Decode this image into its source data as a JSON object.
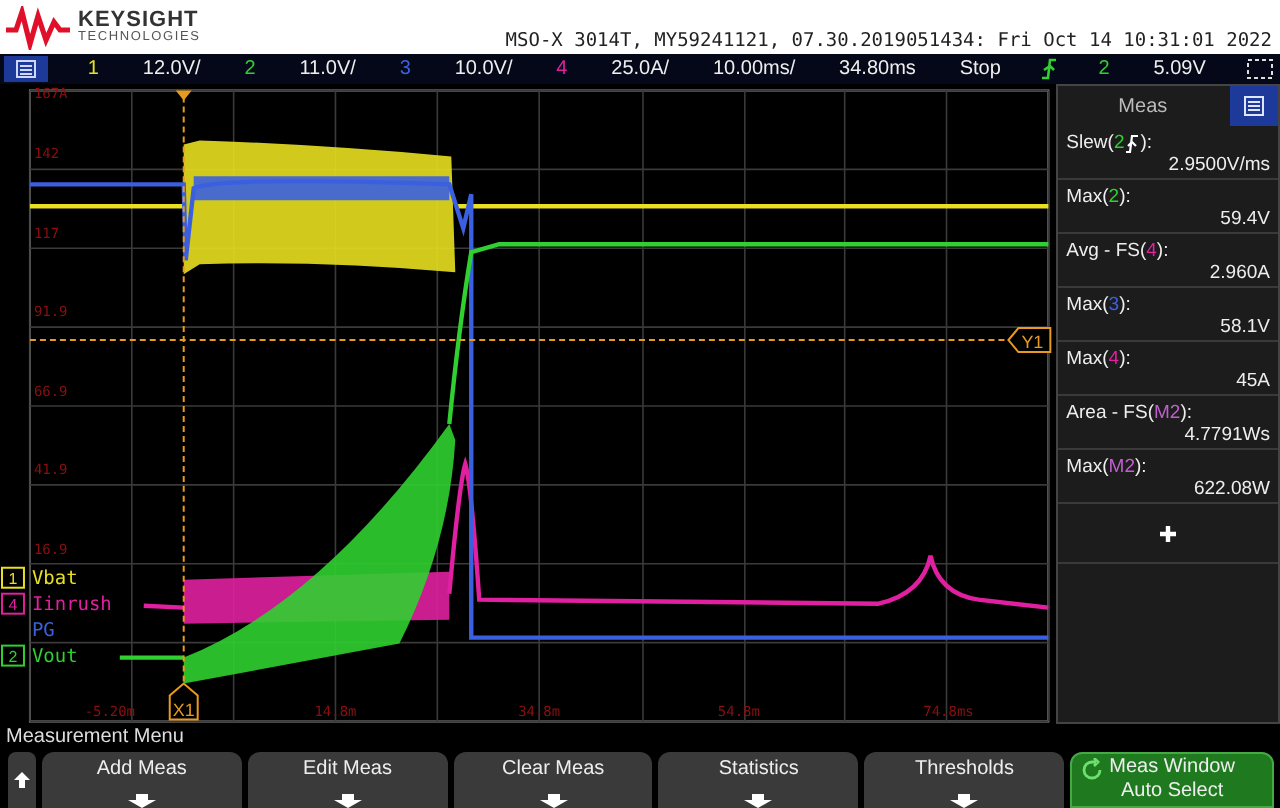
{
  "header": {
    "brand": "KEYSIGHT",
    "brand_sub": "TECHNOLOGIES",
    "instrument": "MSO-X 3014T, MY59241121, 07.30.2019051434: Fri Oct 14 10:31:01 2022"
  },
  "channel_bar": {
    "channels": [
      {
        "number": "1",
        "scale": "12.0V/",
        "color": "#e8e020"
      },
      {
        "number": "2",
        "scale": "11.0V/",
        "color": "#30d030"
      },
      {
        "number": "3",
        "scale": "10.0V/",
        "color": "#3a60e0"
      },
      {
        "number": "4",
        "scale": "25.0A/",
        "color": "#e020a0"
      }
    ],
    "timebase": "10.00ms/",
    "delay": "34.80ms",
    "run_state": "Stop",
    "trigger": {
      "source": "2",
      "color": "#30d030",
      "level": "5.09V"
    }
  },
  "display": {
    "y_labels": [
      "167A",
      "142",
      "117",
      "91.9",
      "66.9",
      "41.9",
      "16.9"
    ],
    "x_labels": [
      "-5.20m",
      "14.8m",
      "34.8m",
      "54.8m",
      "74.8ms"
    ],
    "x_cursor": "X1",
    "y_cursor": "Y1",
    "traces": [
      {
        "label": "Vbat",
        "number": "1",
        "color": "#e8e020"
      },
      {
        "label": "Iinrush",
        "number": "4",
        "color": "#e020a0"
      },
      {
        "label": "PG",
        "color": "#3a60e0"
      },
      {
        "label": "Vout",
        "number": "2",
        "color": "#30d030"
      }
    ]
  },
  "meas_panel": {
    "title": "Meas",
    "items": [
      {
        "prefix": "Slew(",
        "source": "2",
        "color": "#30d030",
        "edge": true,
        "suffix": "):",
        "value": "2.9500V/ms"
      },
      {
        "prefix": "Max(",
        "source": "2",
        "color": "#30d030",
        "edge": false,
        "suffix": "):",
        "value": "59.4V"
      },
      {
        "prefix": "Avg - FS(",
        "source": "4",
        "color": "#e020a0",
        "edge": false,
        "suffix": "):",
        "value": "2.960A"
      },
      {
        "prefix": "Max(",
        "source": "3",
        "color": "#3a60e0",
        "edge": false,
        "suffix": "):",
        "value": "58.1V"
      },
      {
        "prefix": "Max(",
        "source": "4",
        "color": "#e020a0",
        "edge": false,
        "suffix": "):",
        "value": "45A"
      },
      {
        "prefix": "Area - FS(",
        "source": "M2",
        "color": "#c060d0",
        "edge": false,
        "suffix": "):",
        "value": "4.7791Ws"
      },
      {
        "prefix": "Max(",
        "source": "M2",
        "color": "#c060d0",
        "edge": false,
        "suffix": "):",
        "value": "622.08W"
      }
    ]
  },
  "menu": {
    "title": "Measurement Menu",
    "buttons": [
      {
        "kind": "softkey",
        "lines": [
          "Add Meas"
        ]
      },
      {
        "kind": "softkey",
        "lines": [
          "Edit Meas"
        ]
      },
      {
        "kind": "softkey",
        "lines": [
          "Clear Meas"
        ]
      },
      {
        "kind": "softkey",
        "lines": [
          "Statistics"
        ]
      },
      {
        "kind": "softkey",
        "lines": [
          "Thresholds"
        ]
      },
      {
        "kind": "toggle",
        "lines": [
          "Meas Window",
          "Auto Select"
        ]
      }
    ]
  }
}
